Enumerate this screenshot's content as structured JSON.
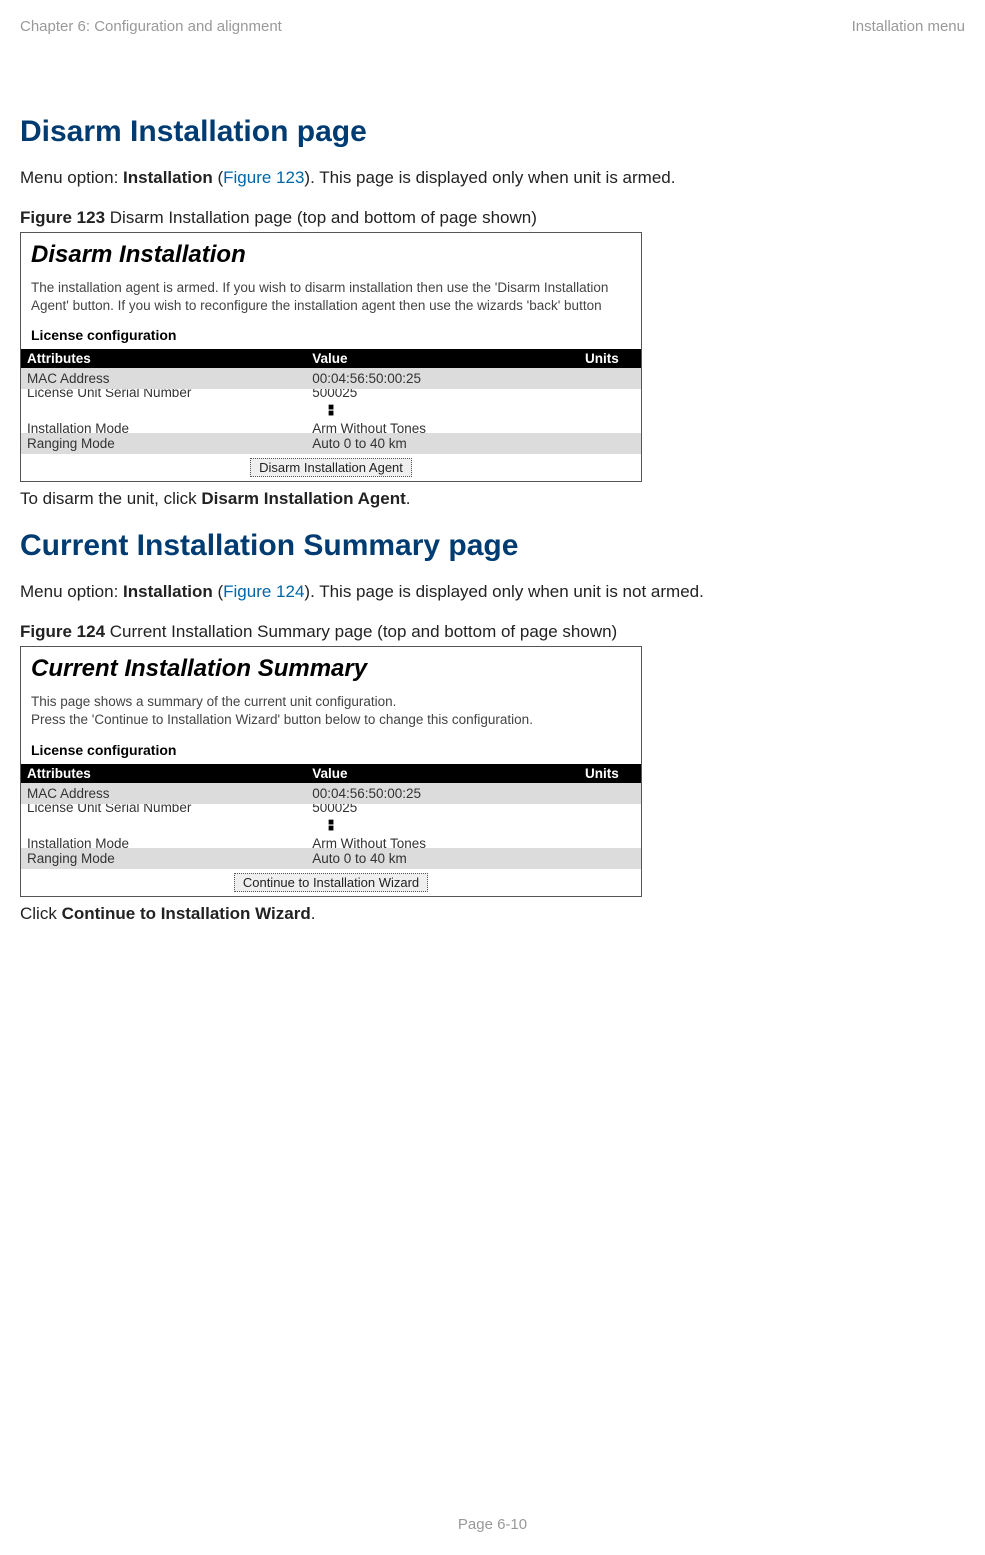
{
  "header": {
    "left": "Chapter 6:  Configuration and alignment",
    "right": "Installation menu"
  },
  "section1": {
    "title": "Disarm Installation page",
    "intro_prefix": "Menu option: ",
    "intro_bold": "Installation",
    "intro_paren_open": " (",
    "intro_link": "Figure 123",
    "intro_suffix": "). This page is displayed only when unit is armed.",
    "fig_label": "Figure 123",
    "fig_caption": "  Disarm Installation page (top and bottom of page shown)",
    "fig_title": "Disarm Installation",
    "fig_desc": "The installation agent is armed. If you wish to disarm installation then use the 'Disarm Installation Agent' button. If you wish to reconfigure the installation agent then use the wizards 'back' button",
    "subhead": "License configuration",
    "th_attr": "Attributes",
    "th_val": "Value",
    "th_units": "Units",
    "rows_top": [
      {
        "attr": "MAC Address",
        "val": "00:04:56:50:00:25",
        "units": ""
      },
      {
        "attr": "License Unit Serial Number",
        "val": "500025",
        "units": ""
      }
    ],
    "rows_bottom": [
      {
        "attr": "Installation Mode",
        "val": "Arm Without Tones",
        "units": ""
      },
      {
        "attr": "Ranging Mode",
        "val": "Auto 0 to 40 km",
        "units": ""
      }
    ],
    "button": "Disarm Installation Agent",
    "after_prefix": "To disarm the unit, click ",
    "after_bold": "Disarm Installation Agent",
    "after_suffix": "."
  },
  "section2": {
    "title": "Current Installation Summary page",
    "intro_prefix": "Menu option: ",
    "intro_bold": "Installation",
    "intro_paren_open": " (",
    "intro_link": "Figure 124",
    "intro_suffix": "). This page is displayed only when unit is not armed.",
    "fig_label": "Figure 124",
    "fig_caption": "  Current Installation Summary page (top and bottom of page shown)",
    "fig_title": "Current Installation Summary",
    "fig_desc": "This page shows a summary of the current unit configuration.\nPress the 'Continue to Installation Wizard' button below to change this configuration.",
    "subhead": "License configuration",
    "th_attr": "Attributes",
    "th_val": "Value",
    "th_units": "Units",
    "rows_top": [
      {
        "attr": "MAC Address",
        "val": "00:04:56:50:00:25",
        "units": ""
      },
      {
        "attr": "License Unit Serial Number",
        "val": "500025",
        "units": ""
      }
    ],
    "rows_bottom": [
      {
        "attr": "Installation Mode",
        "val": "Arm Without Tones",
        "units": ""
      },
      {
        "attr": "Ranging Mode",
        "val": "Auto 0 to 40 km",
        "units": ""
      }
    ],
    "button": "Continue to Installation Wizard",
    "after_prefix": "Click ",
    "after_bold": "Continue to Installation Wizard",
    "after_suffix": "."
  },
  "footer": "Page 6-10"
}
